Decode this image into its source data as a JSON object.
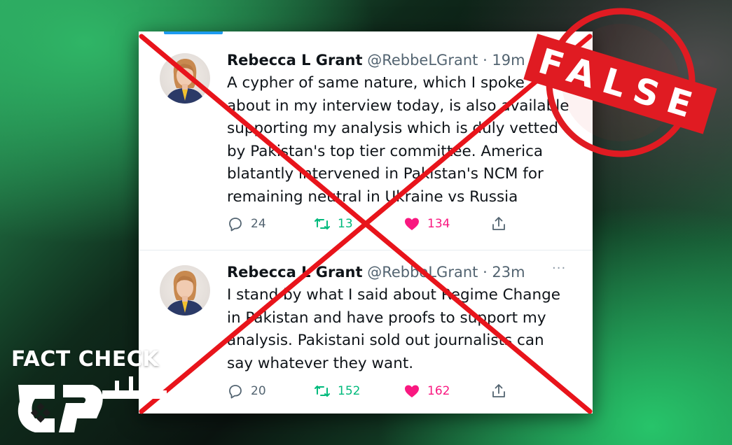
{
  "fact_check": {
    "label": "FACT CHECK",
    "verdict": "FALSE"
  },
  "colors": {
    "cross": "#e8141b",
    "stamp_red": "#e01b22",
    "like_pink": "#f91880",
    "retweet_green": "#00ba7c",
    "twitter_blue": "#1d9bf0"
  },
  "tweets": [
    {
      "display_name": "Rebecca L Grant",
      "handle": "@RebbeLGrant",
      "time": "· 19m",
      "lines": [
        "A cypher of same nature, which I spoke",
        "about in my interview today, is also available",
        "supporting my analysis which is duly vetted",
        "by Pakistan's top tier committee. America",
        "blatantly intervened in Pakistan's NCM for",
        "remaining neutral in Ukraine vs Russia"
      ],
      "replies": "24",
      "retweets": "13",
      "likes": "134",
      "icons": {
        "reply": "reply-icon",
        "retweet": "retweet-icon",
        "like": "heart-icon",
        "share": "share-icon"
      }
    },
    {
      "display_name": "Rebecca L Grant",
      "handle": "@RebbeLGrant",
      "time": "· 23m",
      "more": "···",
      "lines": [
        "I stand by what I said about Regime Change",
        "in Pakistan and have proofs to support my",
        "analysis. Pakistani sold out journalists can",
        "say whatever they want."
      ],
      "replies": "20",
      "retweets": "152",
      "likes": "162",
      "icons": {
        "reply": "reply-icon",
        "retweet": "retweet-icon",
        "like": "heart-icon",
        "share": "share-icon"
      }
    }
  ]
}
